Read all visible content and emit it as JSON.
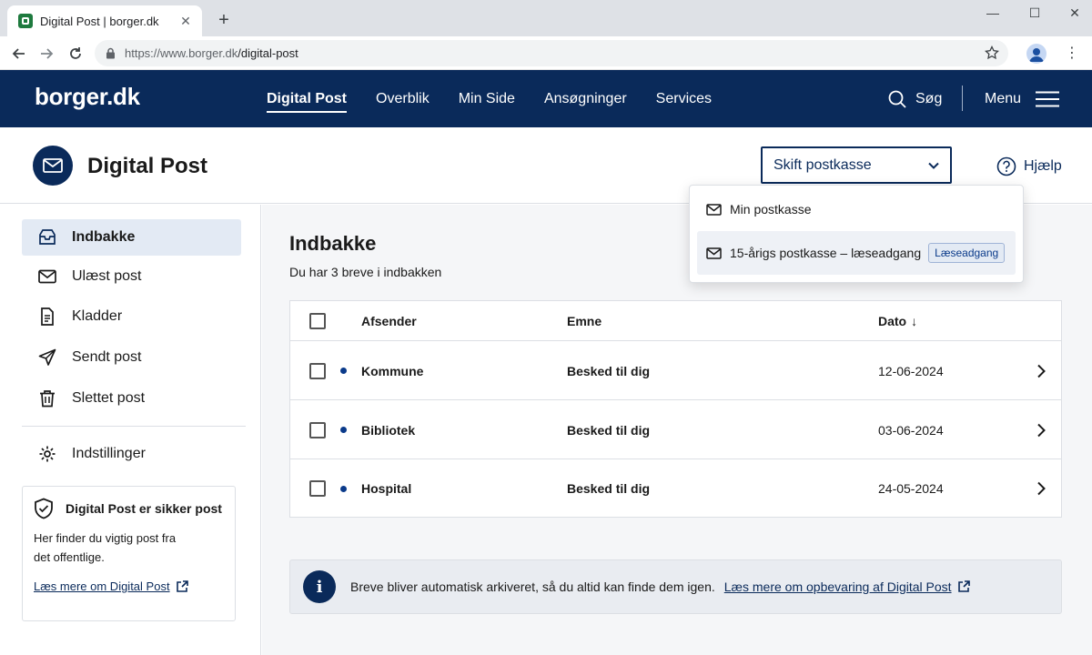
{
  "browser": {
    "tab_title": "Digital Post | borger.dk",
    "tab_close": "✕",
    "new_tab": "+",
    "url_host": "https://www.borger.dk",
    "url_path": "/digital-post",
    "win_min": "—",
    "win_max": "☐",
    "win_close": "✕",
    "kebab": "⋮"
  },
  "header": {
    "logo": "borger.dk",
    "nav": [
      "Digital Post",
      "Overblik",
      "Min Side",
      "Ansøgninger",
      "Services"
    ],
    "search_label": "Søg",
    "menu_label": "Menu"
  },
  "page": {
    "title": "Digital Post",
    "switch_label": "Skift postkasse",
    "help_label": "Hjælp"
  },
  "sidebar": {
    "items": [
      {
        "label": "Indbakke",
        "icon": "inbox-icon"
      },
      {
        "label": "Ulæst post",
        "icon": "envelope-icon"
      },
      {
        "label": "Kladder",
        "icon": "document-icon"
      },
      {
        "label": "Sendt post",
        "icon": "send-icon"
      },
      {
        "label": "Slettet post",
        "icon": "trash-icon"
      }
    ],
    "settings_label": "Indstillinger",
    "card": {
      "title": "Digital Post er sikker post",
      "text": "Her finder du vigtig post fra det offentlige.",
      "link": "Læs mere om Digital Post"
    }
  },
  "main": {
    "title": "Indbakke",
    "subtitle": "Du har 3 breve i indbakken",
    "columns": {
      "sender": "Afsender",
      "subject": "Emne",
      "date": "Dato",
      "sort_arrow": "↓"
    },
    "rows": [
      {
        "sender": "Kommune",
        "subject": "Besked til dig",
        "date": "12-06-2024"
      },
      {
        "sender": "Bibliotek",
        "subject": "Besked til dig",
        "date": "03-06-2024"
      },
      {
        "sender": "Hospital",
        "subject": "Besked til dig",
        "date": "24-05-2024"
      }
    ],
    "notice": {
      "text": "Breve bliver automatisk arkiveret, så du altid kan finde dem igen.",
      "link": "Læs mere om opbevaring af Digital Post"
    }
  },
  "dropdown": {
    "items": [
      {
        "label": "Min postkasse"
      },
      {
        "label": "15-årigs postkasse – læseadgang",
        "badge": "Læseadgang"
      }
    ]
  },
  "colors": {
    "brand_navy": "#0a2a5a",
    "unread_dot": "#0a3a8a",
    "active_bg": "#e3eaf4"
  }
}
